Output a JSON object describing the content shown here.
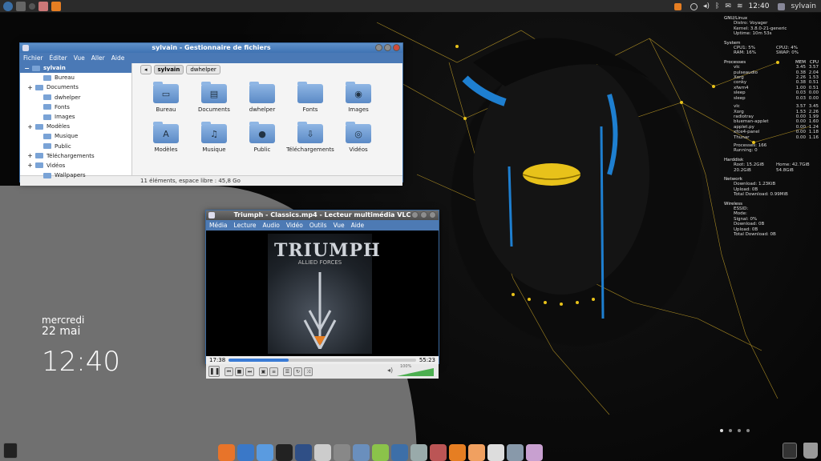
{
  "top_panel": {
    "username": "sylvain",
    "clock": "12:40"
  },
  "file_manager": {
    "title": "sylvain - Gestionnaire de fichiers",
    "menu": [
      "Fichier",
      "Éditer",
      "Vue",
      "Aller",
      "Aide"
    ],
    "sidebar": [
      {
        "label": "sylvain",
        "expander": "−",
        "selected": true
      },
      {
        "label": "Bureau",
        "expander": ""
      },
      {
        "label": "Documents",
        "expander": "+"
      },
      {
        "label": "dwhelper",
        "expander": ""
      },
      {
        "label": "Fonts",
        "expander": ""
      },
      {
        "label": "Images",
        "expander": ""
      },
      {
        "label": "Modèles",
        "expander": "+"
      },
      {
        "label": "Musique",
        "expander": ""
      },
      {
        "label": "Public",
        "expander": ""
      },
      {
        "label": "Téléchargements",
        "expander": "+"
      },
      {
        "label": "Vidéos",
        "expander": "+"
      },
      {
        "label": "Wallpapers",
        "expander": ""
      }
    ],
    "breadcrumbs": [
      "sylvain",
      "dwhelper"
    ],
    "items": [
      {
        "label": "Bureau",
        "icon": "desktop-folder-icon",
        "glyph": "▭"
      },
      {
        "label": "Documents",
        "icon": "documents-folder-icon",
        "glyph": "▤"
      },
      {
        "label": "dwhelper",
        "icon": "folder-icon",
        "glyph": ""
      },
      {
        "label": "Fonts",
        "icon": "folder-icon",
        "glyph": ""
      },
      {
        "label": "Images",
        "icon": "camera-folder-icon",
        "glyph": "◉"
      },
      {
        "label": "Modèles",
        "icon": "templates-folder-icon",
        "glyph": "A"
      },
      {
        "label": "Musique",
        "icon": "music-folder-icon",
        "glyph": "♫"
      },
      {
        "label": "Public",
        "icon": "public-folder-icon",
        "glyph": "●"
      },
      {
        "label": "Téléchargements",
        "icon": "download-folder-icon",
        "glyph": "⇩"
      },
      {
        "label": "Vidéos",
        "icon": "video-folder-icon",
        "glyph": "◎"
      }
    ],
    "status": "11 éléments, espace libre : 45,8 Go"
  },
  "vlc": {
    "title": "Triumph - Classics.mp4 - Lecteur multimédia VLC",
    "menu": [
      "Média",
      "Lecture",
      "Audio",
      "Vidéo",
      "Outils",
      "Vue",
      "Aide"
    ],
    "album_title": "TRIUMPH",
    "album_subtitle": "ALLIED FORCES",
    "elapsed": "17:38",
    "total": "55:23",
    "progress": 0.32,
    "volume": "100%",
    "volume_level": 1.0
  },
  "clock_widget": {
    "day": "mercredi",
    "date": "22 mai",
    "time": "12:40"
  },
  "conky": {
    "header": "GNU/Linux",
    "distro": "Distro: Voyager",
    "kernel": "Kernel: 3.8.0-21-generic",
    "uptime": "Uptime: 10m 53s",
    "system_label": "System",
    "cpu1": "CPU1: 5%",
    "cpu2": "CPU2: 4%",
    "ram": "RAM: 16%",
    "swap": "SWAP: 0%",
    "processes_label": "Processes",
    "mem_col": "MEM",
    "cpu_col": "CPU",
    "proc_top": [
      {
        "name": "vlc",
        "mem": "3.45",
        "cpu": "3.57"
      },
      {
        "name": "pulseaudio",
        "mem": "0.38",
        "cpu": "2.04"
      },
      {
        "name": "Xorg",
        "mem": "2.26",
        "cpu": "1.53"
      },
      {
        "name": "conky",
        "mem": "0.38",
        "cpu": "0.51"
      },
      {
        "name": "xfwm4",
        "mem": "1.00",
        "cpu": "0.51"
      },
      {
        "name": "sleep",
        "mem": "0.03",
        "cpu": "0.00"
      },
      {
        "name": "sleep",
        "mem": "0.03",
        "cpu": "0.00"
      }
    ],
    "proc_mem": [
      {
        "name": "vlc",
        "mem": "3.57",
        "cpu": "3.45"
      },
      {
        "name": "Xorg",
        "mem": "1.53",
        "cpu": "2.26"
      },
      {
        "name": "radiotray",
        "mem": "0.00",
        "cpu": "1.99"
      },
      {
        "name": "blueman-applet",
        "mem": "0.00",
        "cpu": "1.60"
      },
      {
        "name": "applet.py",
        "mem": "0.00",
        "cpu": "1.24"
      },
      {
        "name": "xfce4-panel",
        "mem": "0.00",
        "cpu": "1.18"
      },
      {
        "name": "Thunar",
        "mem": "0.00",
        "cpu": "1.16"
      }
    ],
    "processes_count": "Processes: 166",
    "running": "Running: 0",
    "harddisk_label": "Harddisk",
    "root": "Root: 15.2GiB",
    "home": "Home: 42.7GiB",
    "root_size": "20.2GiB",
    "home_size": "54.8GiB",
    "network_label": "Network",
    "download": "Download: 1.23KiB",
    "upload": "Upload: 0B",
    "total_download": "Total Download: 0.99MiB",
    "wireless_label": "Wireless",
    "essid": "ESSID:",
    "mode": "Mode:",
    "signal": "Signal: 0%",
    "w_download": "Download: 0B",
    "w_upload": "Upload: 0B",
    "w_total": "Total Download: 0B"
  },
  "dock_icons": [
    "firefox-icon",
    "thunderbird-icon",
    "users-icon",
    "terminal-icon",
    "text-editor-icon",
    "notes-icon",
    "screenshot-icon",
    "file-manager-icon",
    "download-icon",
    "image-viewer-icon",
    "search-icon",
    "video-capture-icon",
    "vlc-icon",
    "burn-icon",
    "disc-icon",
    "settings-icon",
    "install-icon"
  ],
  "colors": {
    "accent": "#4a79b6",
    "gold": "#f5c518"
  }
}
